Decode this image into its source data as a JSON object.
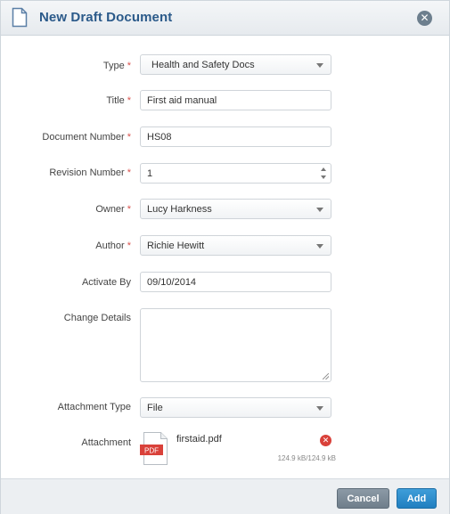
{
  "dialog": {
    "title": "New Draft Document"
  },
  "form": {
    "type": {
      "label": "Type",
      "value": "Health and Safety Docs",
      "required": true
    },
    "title": {
      "label": "Title",
      "value": "First aid manual",
      "required": true
    },
    "document_number": {
      "label": "Document Number",
      "value": "HS08",
      "required": true
    },
    "revision_number": {
      "label": "Revision Number",
      "value": "1",
      "required": true
    },
    "owner": {
      "label": "Owner",
      "value": "Lucy Harkness",
      "required": true
    },
    "author": {
      "label": "Author",
      "value": "Richie Hewitt",
      "required": true
    },
    "activate_by": {
      "label": "Activate By",
      "value": "09/10/2014",
      "required": false
    },
    "change_details": {
      "label": "Change Details",
      "value": "",
      "required": false
    },
    "attachment_type": {
      "label": "Attachment Type",
      "value": "File",
      "required": false
    },
    "attachment": {
      "label": "Attachment",
      "file_name": "firstaid.pdf",
      "file_size": "124.9 kB/124.9 kB",
      "file_badge": "PDF"
    },
    "required_marker": "*"
  },
  "footer": {
    "cancel_label": "Cancel",
    "add_label": "Add"
  },
  "colors": {
    "title": "#2b5a8a",
    "required": "#d9534f",
    "add_button": "#2a8bcf",
    "cancel_button": "#7f8d99",
    "remove": "#d9413a",
    "pdf_badge": "#d9413a"
  },
  "icons": {
    "header": "document-icon",
    "close": "close-icon",
    "attachment": "pdf-file-icon",
    "remove": "remove-icon"
  }
}
